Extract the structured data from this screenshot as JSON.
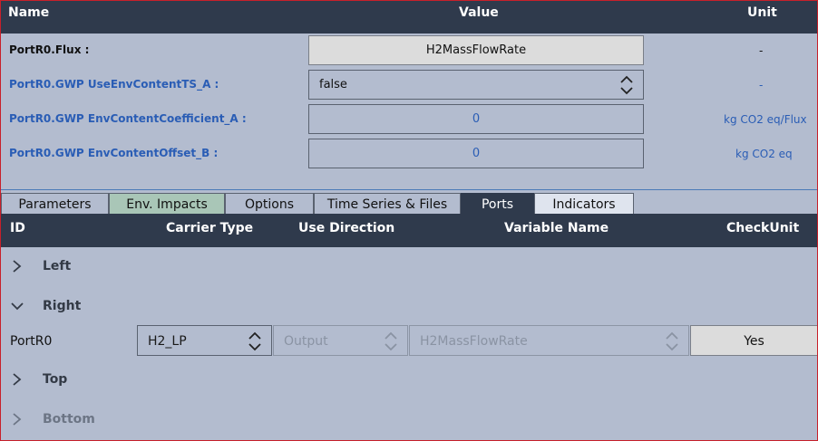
{
  "header": {
    "name": "Name",
    "value": "Value",
    "unit": "Unit"
  },
  "properties": [
    {
      "label": "PortR0.Flux :",
      "value": "H2MassFlowRate",
      "unit": "-"
    },
    {
      "label": "PortR0.GWP UseEnvContentTS_A :",
      "value": "false",
      "unit": "-"
    },
    {
      "label": "PortR0.GWP EnvContentCoefficient_A :",
      "value": "0",
      "unit": "kg CO2 eq/Flux"
    },
    {
      "label": "PortR0.GWP EnvContentOffset_B :",
      "value": "0",
      "unit": "kg CO2 eq"
    }
  ],
  "tabs": [
    {
      "label": "Parameters"
    },
    {
      "label": "Env. Impacts"
    },
    {
      "label": "Options"
    },
    {
      "label": "Time Series & Files"
    },
    {
      "label": "Ports"
    },
    {
      "label": "Indicators"
    }
  ],
  "ports_header": {
    "id": "ID",
    "carrier_type": "Carrier Type",
    "use_direction": "Use Direction",
    "variable_name": "Variable Name",
    "check_unit": "CheckUnit"
  },
  "groups": {
    "left": "Left",
    "right": "Right",
    "top": "Top",
    "bottom": "Bottom"
  },
  "port_row": {
    "id": "PortR0",
    "carrier_type": "H2_LP",
    "use_direction": "Output",
    "variable_name": "H2MassFlowRate",
    "check_unit": "Yes"
  }
}
